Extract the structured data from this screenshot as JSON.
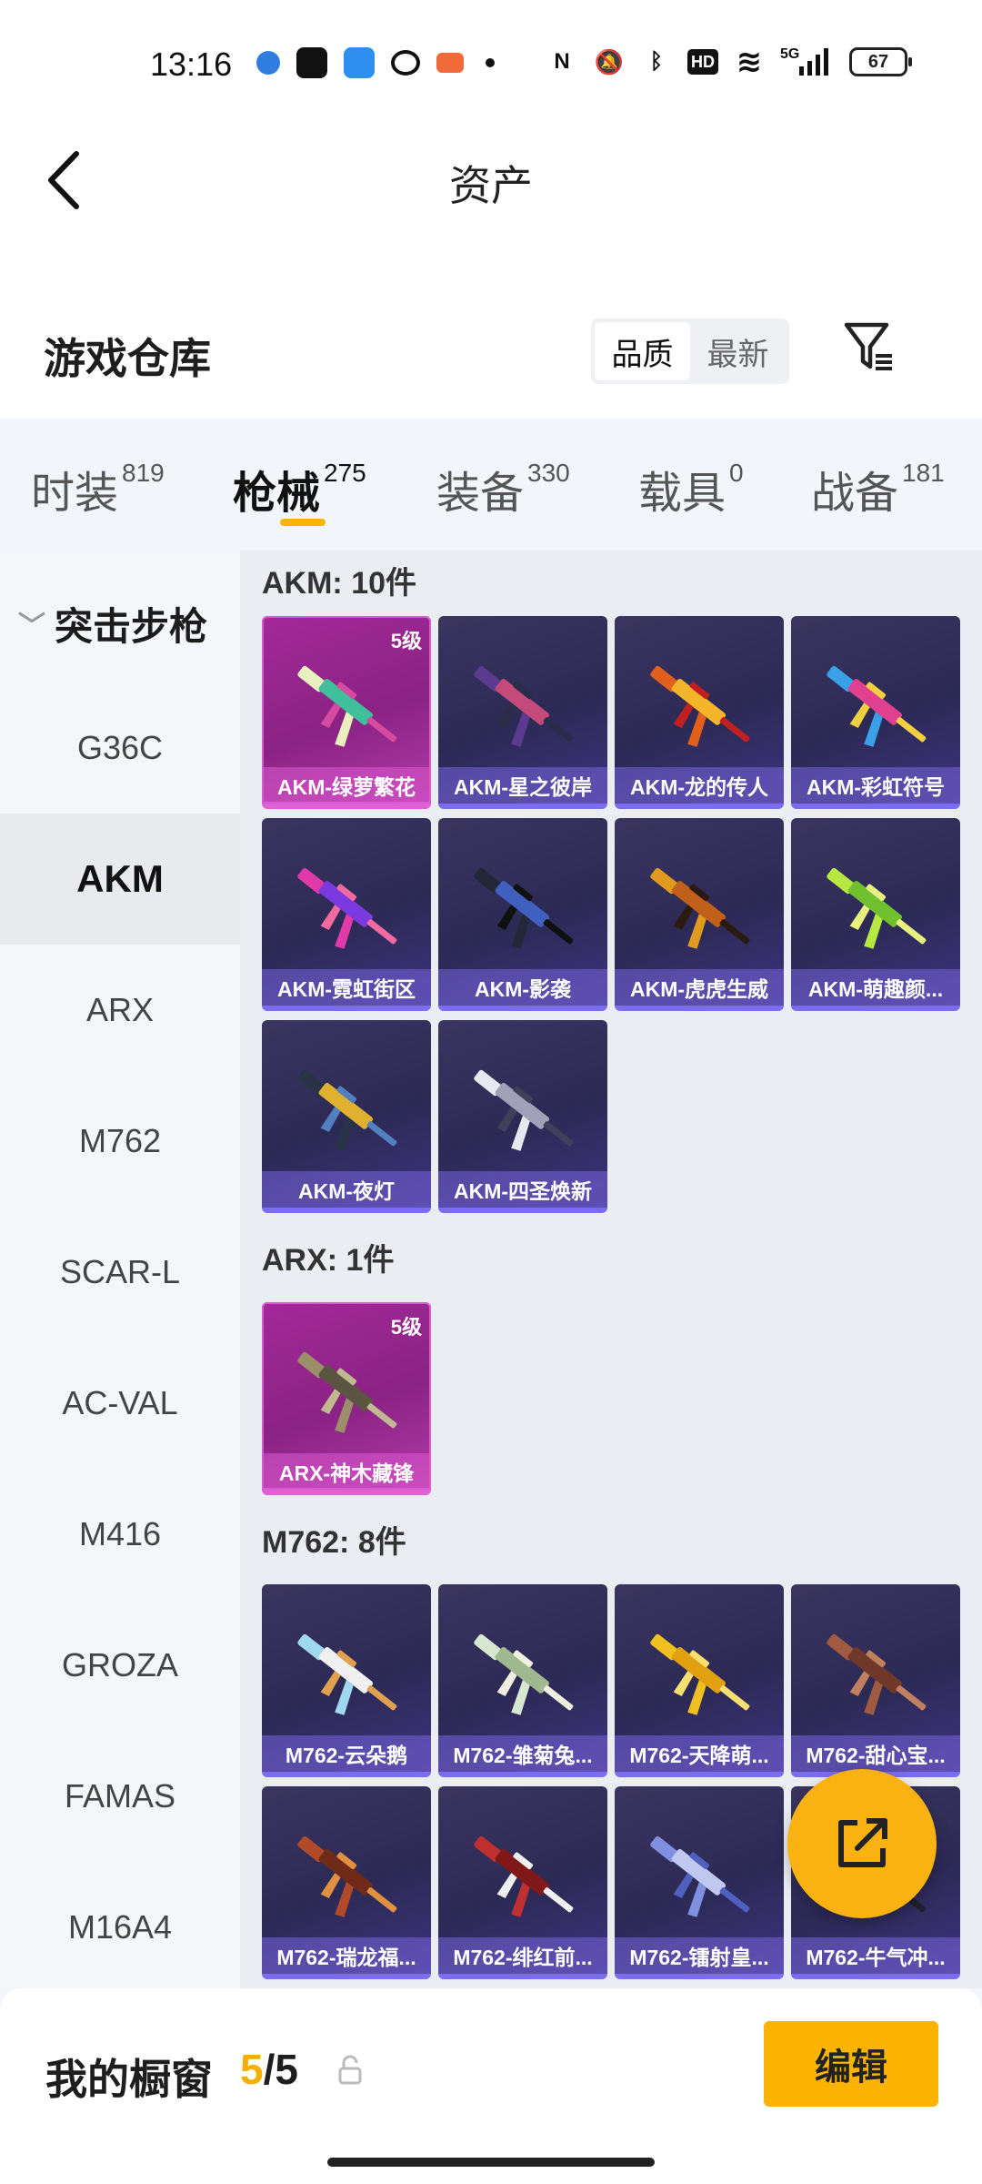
{
  "status_bar": {
    "time": "13:16",
    "battery": "67",
    "left_icons": [
      "weather-app-icon",
      "tiktok-icon",
      "cloud-app-icon",
      "wechat-icon",
      "game-app-icon"
    ],
    "right_icons": [
      "nfc-icon",
      "mute-icon",
      "bluetooth-icon",
      "hd-icon",
      "wifi-icon",
      "signal-5g-icon"
    ],
    "right_icon_text": {
      "nfc": "N",
      "mute": "🔕",
      "bluetooth": "ᛒ",
      "hd": "HD",
      "wifi": "≋",
      "signal": "5G"
    }
  },
  "header": {
    "title": "资产"
  },
  "warehouse": {
    "title": "游戏仓库",
    "sort_options": [
      "品质",
      "最新"
    ],
    "sort_active": "品质"
  },
  "tabs": [
    {
      "label": "时装",
      "count": "819"
    },
    {
      "label": "枪械",
      "count": "275",
      "active": true
    },
    {
      "label": "装备",
      "count": "330"
    },
    {
      "label": "载具",
      "count": "0"
    },
    {
      "label": "战备",
      "count": "181"
    }
  ],
  "sidebar": {
    "group": "突击步枪",
    "items": [
      "G36C",
      "AKM",
      "ARX",
      "M762",
      "SCAR-L",
      "AC-VAL",
      "M416",
      "GROZA",
      "FAMAS",
      "M16A4"
    ],
    "active": "AKM"
  },
  "groups": [
    {
      "title": "AKM: 10件",
      "items": [
        {
          "name": "AKM-绿萝繁花",
          "level": "5级",
          "rarity": "legend",
          "colors": [
            "#e8f0c0",
            "#3fbf9a",
            "#d64aa0"
          ]
        },
        {
          "name": "AKM-星之彼岸",
          "rarity": "epic",
          "colors": [
            "#5b3b8f",
            "#c44a7a",
            "#2b2b4a"
          ]
        },
        {
          "name": "AKM-龙的传人",
          "rarity": "epic",
          "colors": [
            "#e0601c",
            "#f5b52b",
            "#c02020"
          ]
        },
        {
          "name": "AKM-彩虹符号",
          "rarity": "epic",
          "colors": [
            "#3aa0e8",
            "#e04090",
            "#f0d040"
          ]
        },
        {
          "name": "AKM-霓虹街区",
          "rarity": "epic",
          "colors": [
            "#e03aa8",
            "#7a3ae0",
            "#f06aa0"
          ]
        },
        {
          "name": "AKM-影袭",
          "rarity": "epic",
          "colors": [
            "#222838",
            "#4060c0",
            "#101010"
          ]
        },
        {
          "name": "AKM-虎虎生威",
          "rarity": "epic",
          "colors": [
            "#e09a20",
            "#c0601a",
            "#2a1a10"
          ]
        },
        {
          "name": "AKM-萌趣颜...",
          "rarity": "epic",
          "colors": [
            "#b6e840",
            "#70c030",
            "#e8f080"
          ]
        },
        {
          "name": "AKM-夜灯",
          "rarity": "epic",
          "colors": [
            "#2a3248",
            "#e0b030",
            "#5080c0"
          ]
        },
        {
          "name": "AKM-四圣焕新",
          "rarity": "epic",
          "colors": [
            "#e8e8f0",
            "#a0a0b8",
            "#404058"
          ]
        }
      ]
    },
    {
      "title": "ARX: 1件",
      "items": [
        {
          "name": "ARX-神木藏锋",
          "level": "5级",
          "rarity": "legend",
          "colors": [
            "#9a8f68",
            "#5b5440",
            "#c0b890"
          ]
        }
      ]
    },
    {
      "title": "M762: 8件",
      "items": [
        {
          "name": "M762-云朵鹅",
          "rarity": "epic",
          "colors": [
            "#a0d8f0",
            "#f0f0f0",
            "#e0a050"
          ]
        },
        {
          "name": "M762-雏菊兔...",
          "rarity": "epic",
          "colors": [
            "#d8e8d0",
            "#a0b890",
            "#f0f0e0"
          ]
        },
        {
          "name": "M762-天降萌...",
          "rarity": "epic",
          "colors": [
            "#f0c020",
            "#e0a010",
            "#f8e070"
          ]
        },
        {
          "name": "M762-甜心宝...",
          "rarity": "epic",
          "colors": [
            "#a05a40",
            "#703828",
            "#c08060"
          ]
        },
        {
          "name": "M762-瑞龙福...",
          "rarity": "epic",
          "colors": [
            "#b04a28",
            "#702a18",
            "#e09040"
          ]
        },
        {
          "name": "M762-绯红前...",
          "rarity": "epic",
          "colors": [
            "#c03030",
            "#801818",
            "#f0f0f0"
          ]
        },
        {
          "name": "M762-镭射皇...",
          "rarity": "epic",
          "colors": [
            "#8090e0",
            "#c0c8f0",
            "#5060c0"
          ]
        },
        {
          "name": "M762-牛气冲...",
          "rarity": "epic",
          "colors": [
            "#3a3050",
            "#806040",
            "#202030"
          ]
        }
      ]
    }
  ],
  "showcase": {
    "title": "我的橱窗",
    "current": "5",
    "total": "5",
    "edit_label": "编辑"
  }
}
